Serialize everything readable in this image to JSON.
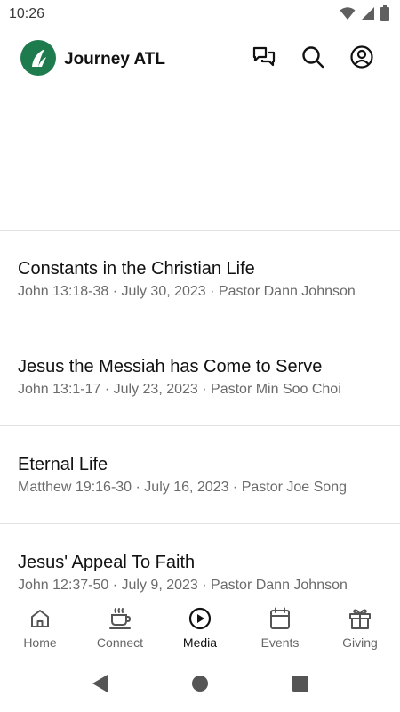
{
  "status_bar": {
    "time": "10:26",
    "icons": [
      "wifi-icon",
      "cellular-signal-icon",
      "battery-icon"
    ]
  },
  "header": {
    "title": "Journey ATL",
    "logo_color": "#1e7b4e",
    "actions": [
      "chat-icon",
      "search-icon",
      "account-icon"
    ]
  },
  "sermons": [
    {
      "title": "Constants in the Christian Life",
      "meta": "John 13:18-38 · July 30, 2023 · Pastor Dann Johnson"
    },
    {
      "title": "Jesus the Messiah has Come to Serve",
      "meta": "John 13:1-17 · July 23, 2023 · Pastor Min Soo Choi"
    },
    {
      "title": "Eternal Life",
      "meta": "Matthew 19:16-30 · July 16, 2023 · Pastor Joe Song"
    },
    {
      "title": "Jesus' Appeal To Faith",
      "meta": "John 12:37-50 · July 9, 2023 · Pastor Dann Johnson"
    }
  ],
  "bottom_nav": {
    "active": "Media",
    "items": [
      {
        "label": "Home",
        "icon": "home-icon"
      },
      {
        "label": "Connect",
        "icon": "coffee-cup-icon"
      },
      {
        "label": "Media",
        "icon": "play-circle-icon"
      },
      {
        "label": "Events",
        "icon": "calendar-icon"
      },
      {
        "label": "Giving",
        "icon": "gift-icon"
      }
    ]
  },
  "system_nav": [
    "back-icon",
    "home-circle-icon",
    "recents-icon"
  ]
}
